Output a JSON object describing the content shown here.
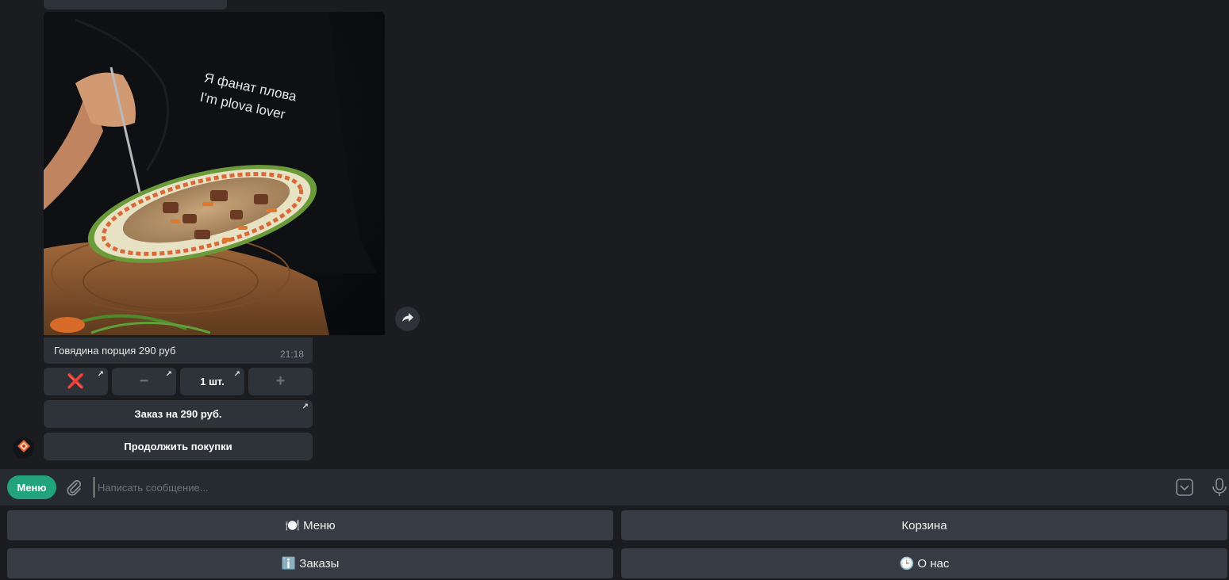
{
  "message": {
    "photo_text_line1": "Я фанат плова",
    "photo_text_line2": "I'm plova lover",
    "caption": "Говядина порция 290 руб",
    "time": "21:18"
  },
  "inline_keyboard": {
    "remove_label": "❌",
    "minus_label": "−",
    "qty_label": "1 шт.",
    "plus_label": "+",
    "order_label": "Заказ на 290 руб.",
    "continue_label": "Продолжить покупки",
    "open_arrow": "↗"
  },
  "composer": {
    "menu_label": "Меню",
    "placeholder": "Написать сообщение..."
  },
  "reply_keyboard": {
    "menu": {
      "emoji": "🍽️",
      "label": "Меню"
    },
    "cart": {
      "label": "Корзина"
    },
    "orders": {
      "emoji": "ℹ️",
      "label": "Заказы"
    },
    "about": {
      "emoji": "🕒",
      "label": "О нас"
    }
  },
  "colors": {
    "background": "#1b1c20",
    "bubble": "#2c3037",
    "accent": "#23a37c",
    "remove_red": "#e0262b"
  },
  "icons": [
    "forward-icon",
    "attach-icon",
    "keyboard-icon",
    "mic-icon",
    "bot-avatar-icon"
  ]
}
